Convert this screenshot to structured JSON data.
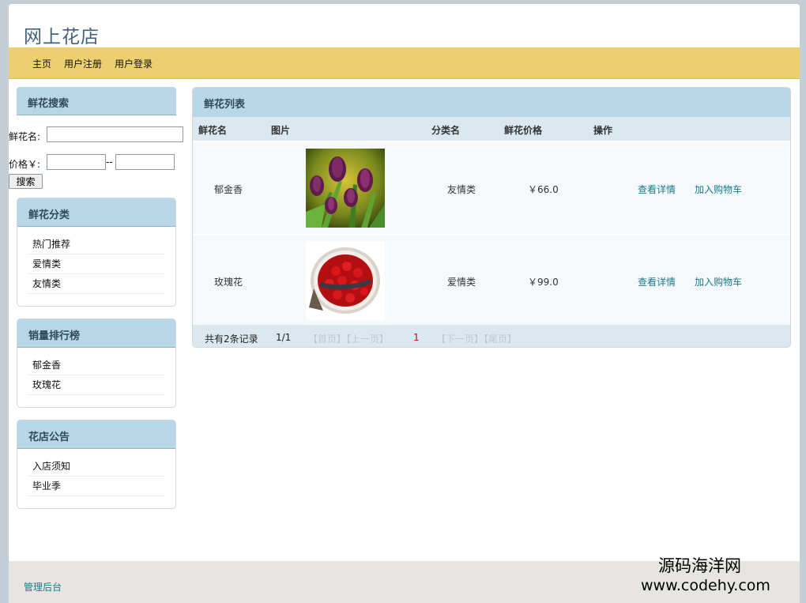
{
  "site": {
    "title": "网上花店"
  },
  "nav": [
    "主页",
    "用户注册",
    "用户登录"
  ],
  "search": {
    "title": "鲜花搜索",
    "name_label": "鲜花名:",
    "name_value": "",
    "price_label": "价格￥:",
    "price_min": "",
    "price_sep": "--",
    "price_max": "",
    "button": "搜索"
  },
  "categories": {
    "title": "鲜花分类",
    "items": [
      "热门推荐",
      "爱情类",
      "友情类"
    ]
  },
  "ranking": {
    "title": "销量排行榜",
    "items": [
      "郁金香",
      "玫瑰花"
    ]
  },
  "notices": {
    "title": "花店公告",
    "items": [
      "入店须知",
      "毕业季"
    ]
  },
  "list": {
    "title": "鲜花列表",
    "columns": [
      "鲜花名",
      "图片",
      "分类名",
      "鲜花价格",
      "操作"
    ],
    "rows": [
      {
        "name": "郁金香",
        "category": "友情类",
        "price": "￥66.0",
        "detail": "查看详情",
        "cart": "加入购物车"
      },
      {
        "name": "玫瑰花",
        "category": "爱情类",
        "price": "￥99.0",
        "detail": "查看详情",
        "cart": "加入购物车"
      }
    ],
    "pager": {
      "total": "共有2条记录",
      "page": "1/1",
      "first_prev": "【首页】【上一页】",
      "current": "1",
      "next_last": "【下一页】【尾页】"
    }
  },
  "footer": {
    "admin": "管理后台"
  },
  "watermark": {
    "line1": "源码海洋网",
    "line2": "www.codehy.com"
  },
  "colors": {
    "nav_bar": "#ecd06f",
    "panel_header": "#b9d6e6",
    "link": "#1a7a8a",
    "pager_current": "#cc0000"
  }
}
